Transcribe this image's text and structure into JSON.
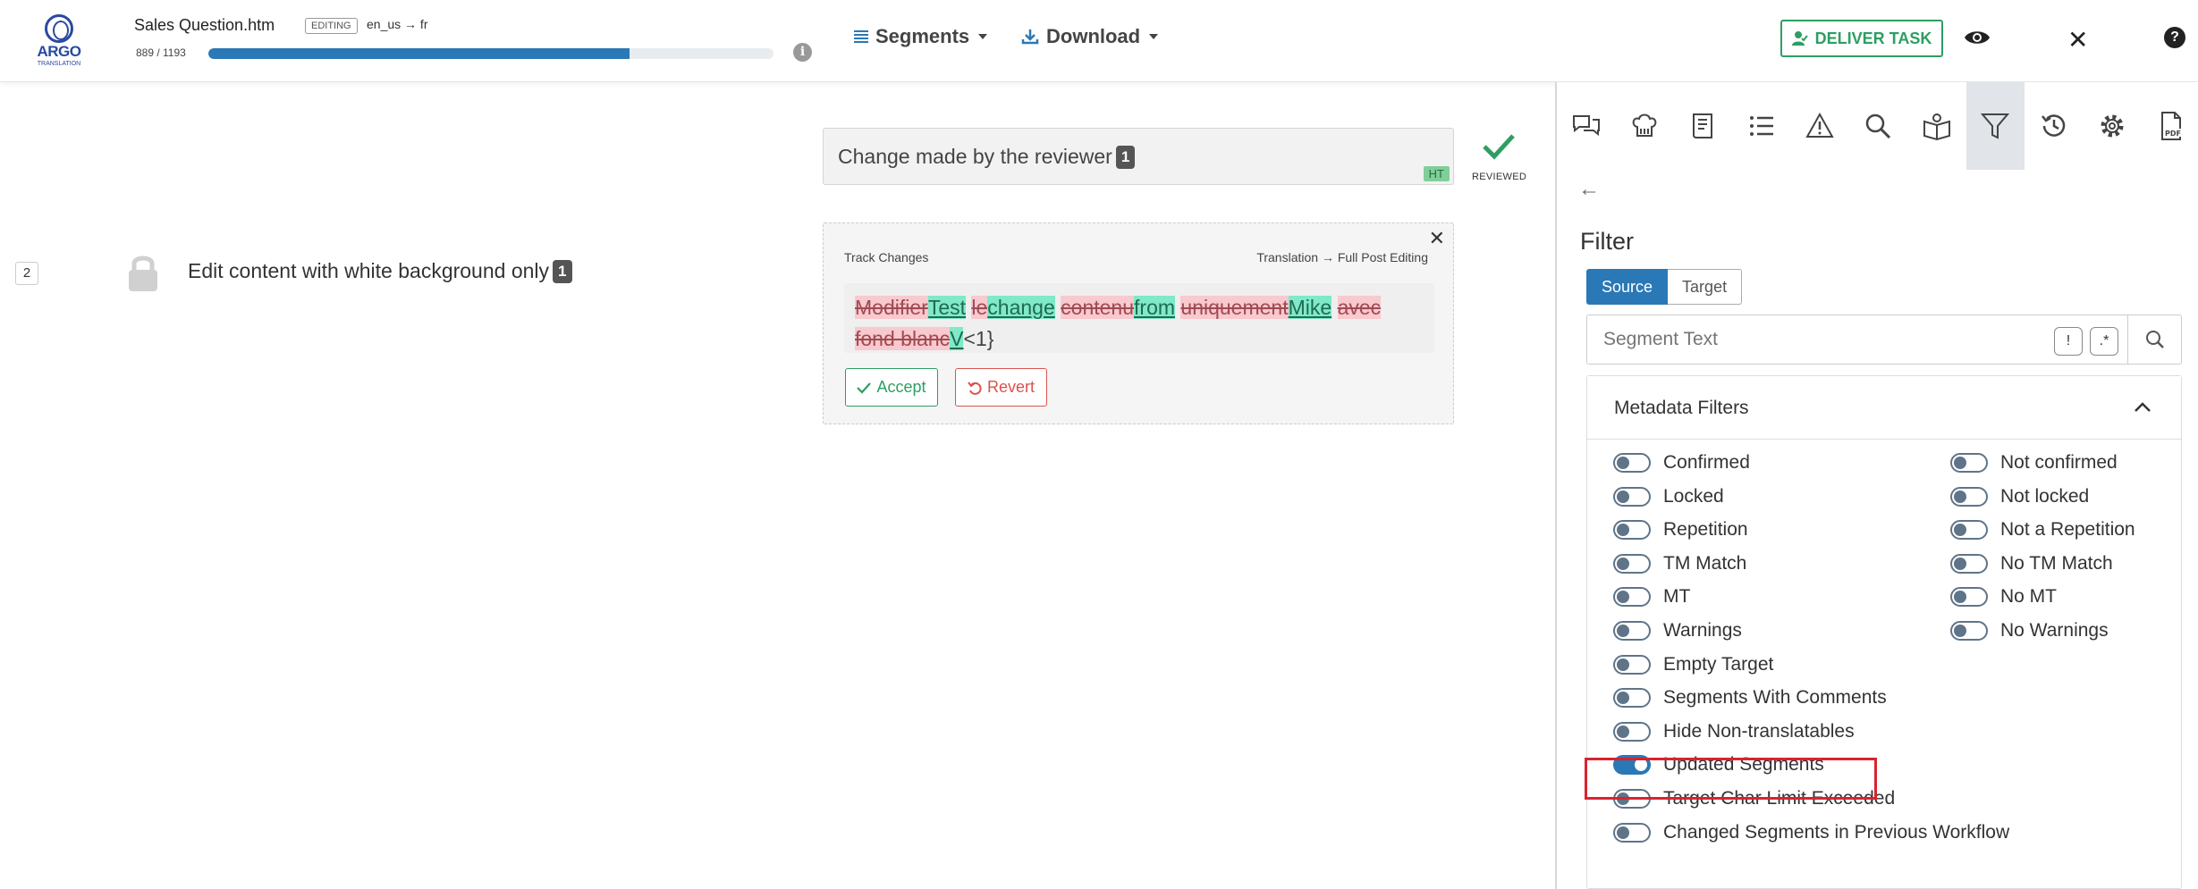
{
  "header": {
    "logo_text": "ARGO",
    "logo_sub": "TRANSLATION",
    "file_name": "Sales Question.htm",
    "mode_badge": "EDITING",
    "lang_pair": "en_us → fr",
    "progress_text": "889 / 1193",
    "progress_fraction": 0.745,
    "segments_label": "Segments",
    "download_label": "Download",
    "deliver_label": "DELIVER TASK",
    "close_glyph": "✕",
    "help_glyph": "?",
    "info_glyph": "i"
  },
  "segment": {
    "number": "2",
    "source_text": "Edit content with white background only",
    "source_tag": "1",
    "target_text": "Change made by the reviewer",
    "target_tag": "1",
    "target_badge": "HT",
    "status_label": "REVIEWED"
  },
  "track_changes": {
    "title": "Track Changes",
    "workflow": "Translation → Full Post Editing",
    "close_glyph": "✕",
    "tokens": [
      {
        "type": "del",
        "text": "Modifier"
      },
      {
        "type": "ins",
        "text": "Test"
      },
      {
        "type": "eq",
        "text": " "
      },
      {
        "type": "del",
        "text": "le"
      },
      {
        "type": "ins",
        "text": "change"
      },
      {
        "type": "eq",
        "text": " "
      },
      {
        "type": "del",
        "text": "contenu"
      },
      {
        "type": "ins",
        "text": "from"
      },
      {
        "type": "eq",
        "text": " "
      },
      {
        "type": "del",
        "text": "uniquement"
      },
      {
        "type": "ins",
        "text": "Mike"
      },
      {
        "type": "eq",
        "text": " "
      },
      {
        "type": "del",
        "text": "avec fond blanc"
      },
      {
        "type": "ins",
        "text": "V"
      },
      {
        "type": "eq",
        "text": "<1}"
      }
    ],
    "accept_label": "Accept",
    "revert_label": "Revert"
  },
  "panel": {
    "back_glyph": "←",
    "filter_title": "Filter",
    "source_label": "Source",
    "target_label": "Target",
    "search_placeholder": "Segment Text",
    "opt_exclaim": "!",
    "opt_regex": ".*",
    "metadata_title": "Metadata Filters",
    "left_filters": [
      {
        "label": "Confirmed",
        "on": false
      },
      {
        "label": "Locked",
        "on": false
      },
      {
        "label": "Repetition",
        "on": false
      },
      {
        "label": "TM Match",
        "on": false
      },
      {
        "label": "MT",
        "on": false
      },
      {
        "label": "Warnings",
        "on": false
      },
      {
        "label": "Empty Target",
        "on": false
      },
      {
        "label": "Segments With Comments",
        "on": false
      },
      {
        "label": "Hide Non-translatables",
        "on": false
      },
      {
        "label": "Updated Segments",
        "on": true
      },
      {
        "label": "Target Char Limit Exceeded",
        "on": false
      },
      {
        "label": "Changed Segments in Previous Workflow",
        "on": false
      }
    ],
    "right_filters": [
      {
        "label": "Not confirmed",
        "on": false
      },
      {
        "label": "Not locked",
        "on": false
      },
      {
        "label": "Not a Repetition",
        "on": false
      },
      {
        "label": "No TM Match",
        "on": false
      },
      {
        "label": "No MT",
        "on": false
      },
      {
        "label": "No Warnings",
        "on": false
      }
    ]
  },
  "colors": {
    "accent": "#2a78b5",
    "success": "#2e9e63",
    "danger": "#d9534f",
    "highlight": "#d9232e"
  },
  "toolbar_icons": [
    "comments-icon",
    "chef-hat-icon",
    "glossary-book-icon",
    "list-icon",
    "warning-icon",
    "search-icon",
    "open-book-icon",
    "filter-icon",
    "history-icon",
    "settings-icon",
    "pdf-icon"
  ]
}
